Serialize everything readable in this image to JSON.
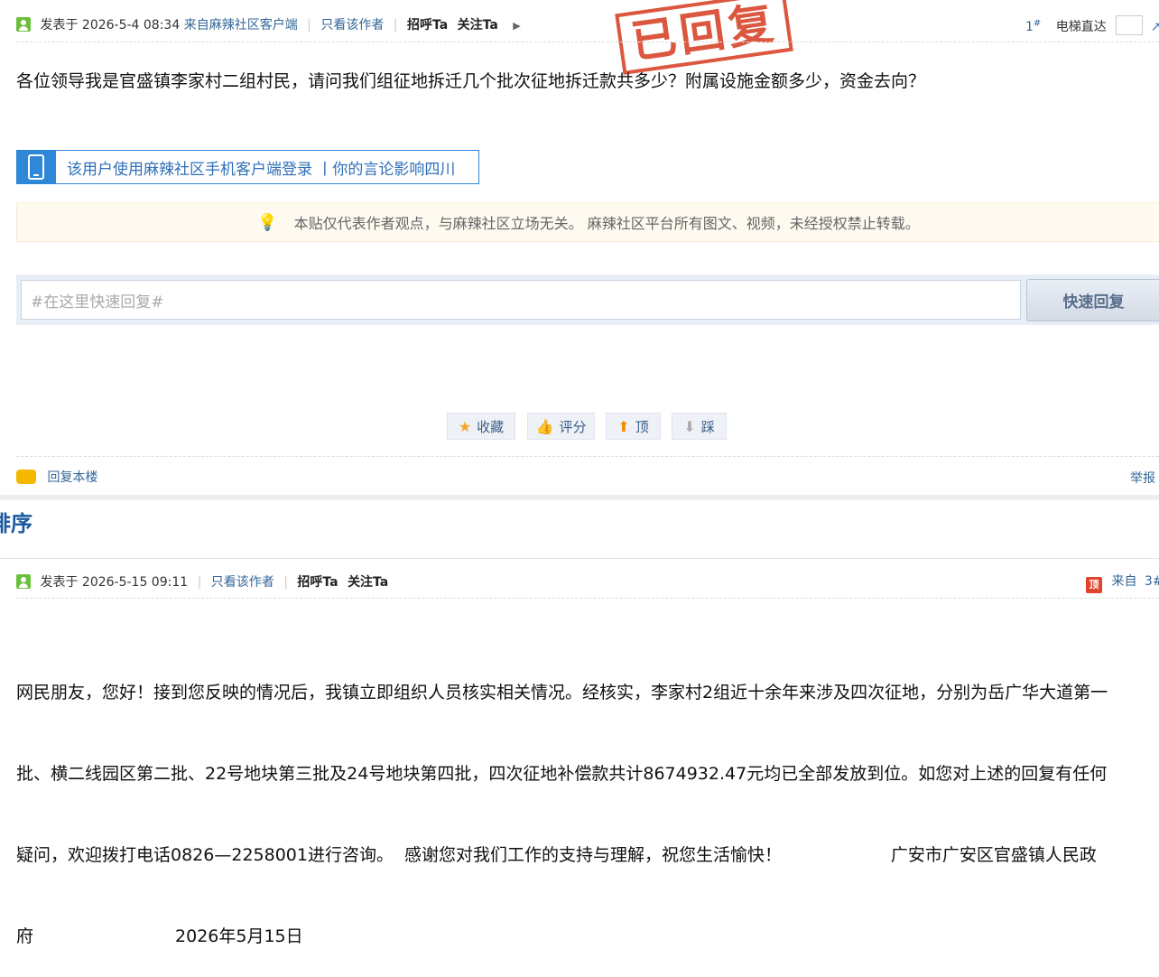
{
  "post1": {
    "posted_prefix": "发表于",
    "posted_time": "2026-5-4 08:34",
    "source": "来自麻辣社区客户端",
    "only_author": "只看该作者",
    "greet": "招呼Ta",
    "follow": "关注Ta",
    "floor": "1",
    "floor_mark": "#",
    "elevator": "电梯直达",
    "stamp_text": "已回复",
    "content": "各位领导我是官盛镇李家村二组村民，请问我们组征地拆迁几个批次征地拆迁款共多少？附属设施金额多少，资金去向？",
    "mobile_banner": "该用户使用麻辣社区手机客户端登录  丨你的言论影响四川",
    "notice": "本贴仅代表作者观点，与麻辣社区立场无关。  麻辣社区平台所有图文、视频，未经授权禁止转载。",
    "quick_reply_placeholder": "#在这里快速回复#",
    "quick_reply_button": "快速回复",
    "actions": [
      {
        "label": "收藏",
        "icon": "star-icon"
      },
      {
        "label": "评分",
        "icon": "thumb-icon"
      },
      {
        "label": "顶",
        "icon": "arrow-up-icon"
      },
      {
        "label": "踩",
        "icon": "arrow-down-icon"
      }
    ],
    "reply_floor": "回复本楼",
    "report": "举报"
  },
  "section_title": "排序",
  "post2": {
    "posted_prefix": "发表于",
    "posted_time": "2026-5-15 09:11",
    "only_author": "只看该作者",
    "greet": "招呼Ta",
    "follow": "关注Ta",
    "badge": "顶",
    "source": "来自",
    "floor": "3#",
    "content_lines": [
      "网民朋友，您好！接到您反映的情况后，我镇立即组织人员核实相关情况。经核实，李家村2组近十余年来涉及四次征地，分别为岳广华大道第一",
      "批、横二线园区第二批、22号地块第三批及24号地块第四批，四次征地补偿款共计8674932.47元均已全部发放到位。如您对上述的回复有任何",
      "疑问，欢迎拨打电话0826—2258001进行咨询。  感谢您对我们工作的支持与理解，祝您生活愉快！                    广安市广安区官盛镇人民政",
      "府                          2026年5月15日"
    ]
  },
  "colors": {
    "link_blue": "#336699",
    "accent_blue": "#2f87d8",
    "stamp_red": "#d9452b",
    "notice_bg": "#fffaf0"
  }
}
